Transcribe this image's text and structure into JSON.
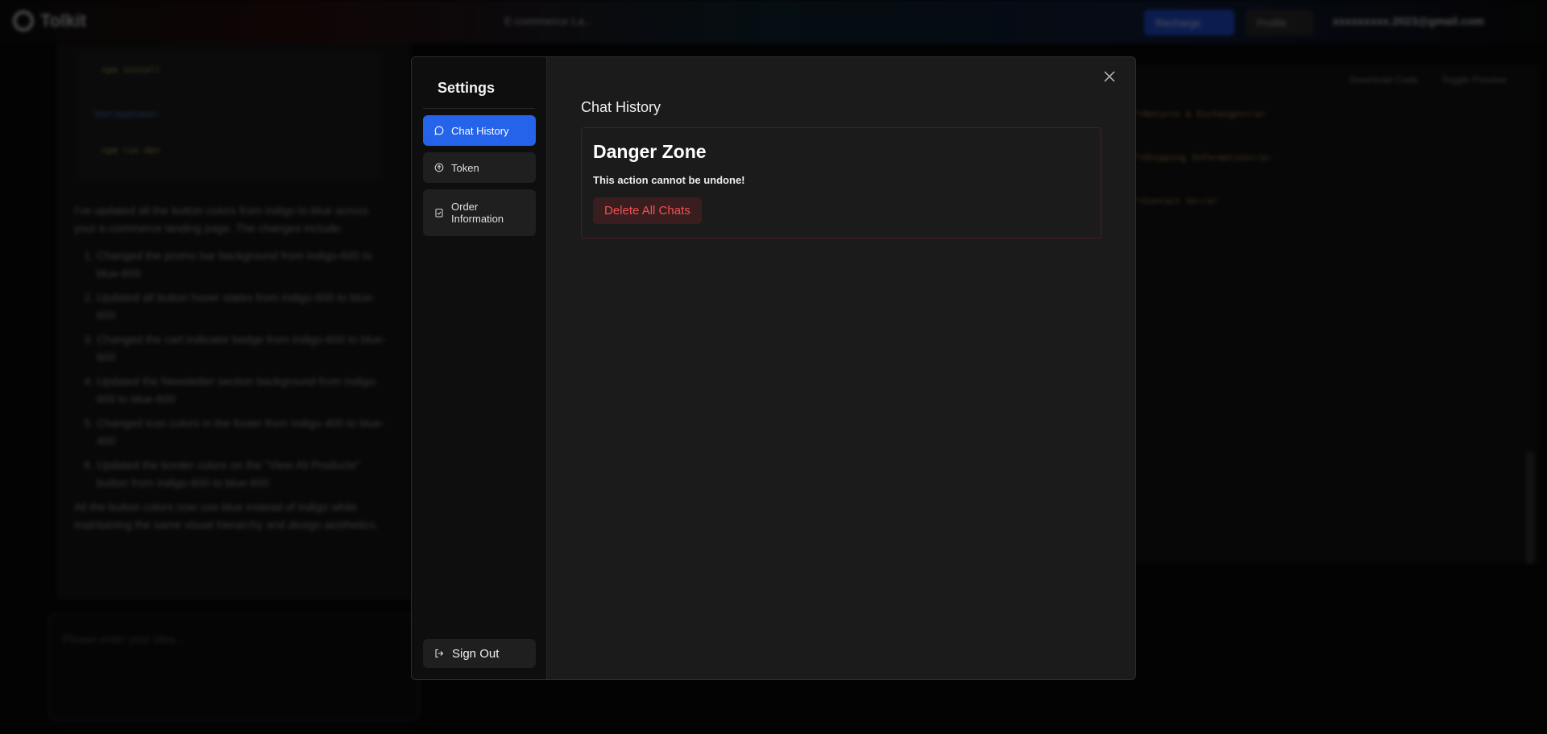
{
  "background": {
    "app_name": "Tolkit",
    "project_name": "E-commerce La...",
    "recharge_label": "Recharge",
    "profile_label": "Profile",
    "user_email": "xxxxxxxxx.2023@gmail.com",
    "code_snippets": [
      "npm install",
      "Start Application",
      "npm run dev"
    ],
    "assistant_message": "I've updated all the button colors from indigo to blue across your e-commerce landing page. The changes include:",
    "changes": [
      "Changed the promo bar background from indigo-600 to blue-600",
      "Updated all button hover states from indigo-600 to blue-600",
      "Changed the cart indicator badge from indigo-600 to blue-600",
      "Updated the Newsletter section background from indigo-600 to blue-600",
      "Changed icon colors in the footer from indigo-400 to blue-400",
      "Updated the border colors on the \"View All Products\" button from indigo-600 to blue-600"
    ],
    "assistant_footer": "All the button colors now use blue instead of indigo while maintaining the same visual hierarchy and design aesthetics.",
    "input_placeholder": "Please enter your idea...",
    "code_tools": [
      "Download Code",
      "Toggle Preview"
    ],
    "code_lines": [
      "\">Returns & Exchanges</a>",
      "\">Shipping Information</a>",
      "\">Contact Us</a>"
    ]
  },
  "modal": {
    "sidebar_title": "Settings",
    "nav": [
      {
        "label": "Chat History",
        "icon": "chat-bubble-icon",
        "active": true
      },
      {
        "label": "Token",
        "icon": "token-icon",
        "active": false
      },
      {
        "label": "Order Information",
        "icon": "clipboard-check-icon",
        "active": false
      }
    ],
    "sign_out_label": "Sign Out",
    "section_title": "Chat History",
    "danger_zone": {
      "title": "Danger Zone",
      "warning": "This action cannot be undone!",
      "delete_label": "Delete All Chats"
    }
  },
  "colors": {
    "accent": "#2563eb",
    "danger_text": "#f05252",
    "danger_bg": "#3a1d1f",
    "danger_border": "#4a1d22"
  }
}
